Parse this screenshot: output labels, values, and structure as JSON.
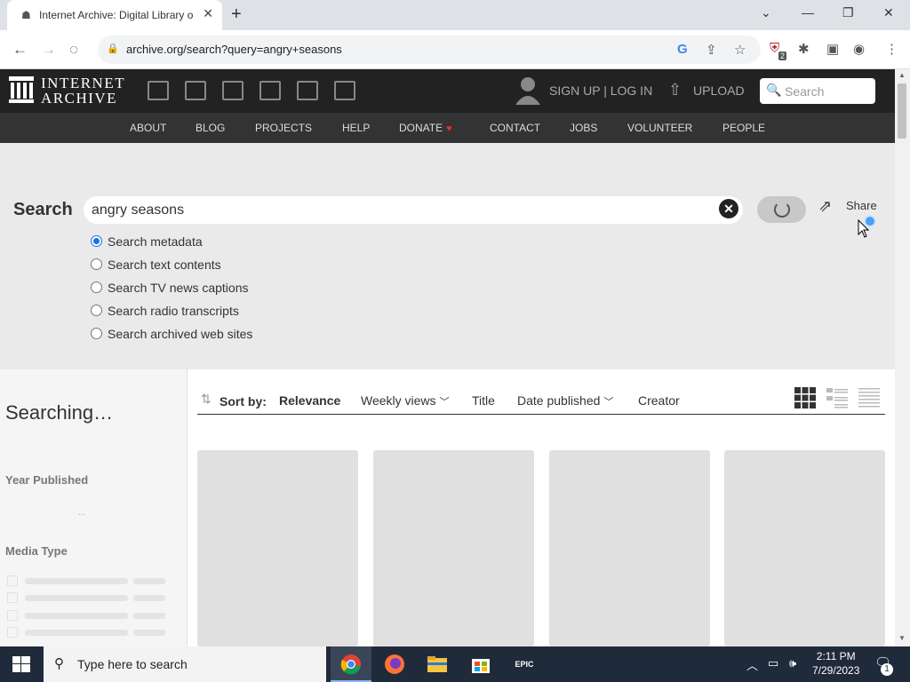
{
  "browser": {
    "tab_title": "Internet Archive: Digital Library o",
    "url": "archive.org/search?query=angry+seasons",
    "extension_badge": "2"
  },
  "header": {
    "logo_line1": "INTERNET",
    "logo_line2": "ARCHIVE",
    "signup_label": "SIGN UP | LOG IN",
    "upload_label": "UPLOAD",
    "search_placeholder": "Search"
  },
  "topnav": {
    "items": [
      "ABOUT",
      "BLOG",
      "PROJECTS",
      "HELP",
      "DONATE",
      "CONTACT",
      "JOBS",
      "VOLUNTEER",
      "PEOPLE"
    ]
  },
  "search": {
    "label": "Search",
    "query": "angry seasons",
    "share_label": "Share",
    "options": [
      {
        "label": "Search metadata",
        "checked": true
      },
      {
        "label": "Search text contents",
        "checked": false
      },
      {
        "label": "Search TV news captions",
        "checked": false
      },
      {
        "label": "Search radio transcripts",
        "checked": false
      },
      {
        "label": "Search archived web sites",
        "checked": false
      }
    ]
  },
  "results": {
    "status": "Searching…",
    "facet_year": "Year Published",
    "facet_media": "Media Type",
    "loading_dots": "...",
    "sort_label": "Sort by:",
    "sort_options": [
      "Relevance",
      "Weekly views",
      "Title",
      "Date published",
      "Creator"
    ],
    "active_sort": "Relevance"
  },
  "taskbar": {
    "search_placeholder": "Type here to search",
    "time": "2:11 PM",
    "date": "7/29/2023",
    "notification_count": "1"
  },
  "colors": {
    "ia_header": "#222222",
    "ia_nav": "#333333",
    "search_bg": "#eaeaea",
    "accent": "#1a73e8",
    "donate_heart": "#e03030"
  }
}
